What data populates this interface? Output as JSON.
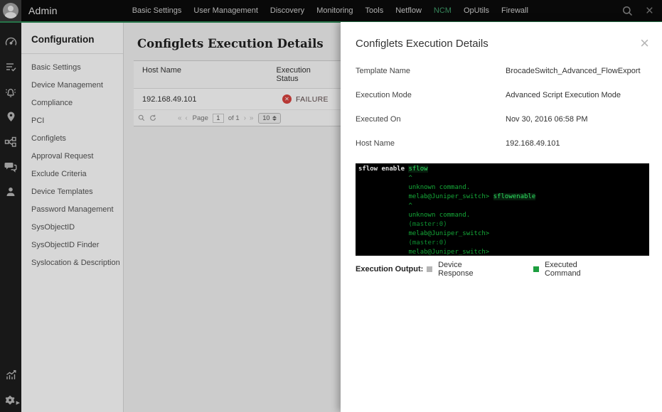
{
  "topbar": {
    "app_title": "Admin",
    "nav": [
      "Basic Settings",
      "User Management",
      "Discovery",
      "Monitoring",
      "Tools",
      "Netflow",
      "NCM",
      "OpUtils",
      "Firewall"
    ],
    "active_nav": "NCM",
    "close_glyph": "×"
  },
  "rail": {
    "icons": [
      "dashboard-gauge-icon",
      "inventory-list-icon",
      "alarm-bell-icon",
      "location-pin-icon",
      "topology-icon",
      "chat-icon",
      "user-icon",
      "reports-graph-icon",
      "settings-gear-icon"
    ]
  },
  "sidebar": {
    "title": "Configuration",
    "items": [
      "Basic Settings",
      "Device Management",
      "Compliance",
      "PCI",
      "Configlets",
      "Approval Request",
      "Exclude Criteria",
      "Device Templates",
      "Password Management",
      "SysObjectID",
      "SysObjectID Finder",
      "Syslocation & Description"
    ]
  },
  "main": {
    "heading": "Configlets Execution Details",
    "table": {
      "columns": [
        "Host Name",
        "Execution Status"
      ],
      "rows": [
        {
          "host_name": "192.168.49.101",
          "status": "FAILURE"
        }
      ]
    },
    "pagination": {
      "first_prev": "« ‹",
      "page_label": "Page",
      "page_value": "1",
      "of_label": "of 1",
      "next_last": "› »",
      "page_size": "10"
    }
  },
  "panel": {
    "title": "Configlets Execution Details",
    "close_glyph": "×",
    "fields": [
      {
        "label": "Template Name",
        "value": "BrocadeSwitch_Advanced_FlowExport"
      },
      {
        "label": "Execution Mode",
        "value": "Advanced Script Execution Mode"
      },
      {
        "label": "Executed On",
        "value": "Nov 30, 2016 06:58 PM"
      },
      {
        "label": "Host Name",
        "value": "192.168.49.101"
      }
    ],
    "terminal": {
      "lines": [
        [
          {
            "t": "sflow enable ",
            "c": "r"
          },
          {
            "t": "sflow",
            "c": "c"
          }
        ],
        [
          {
            "t": "             ^",
            "c": "o"
          }
        ],
        [
          {
            "t": "             unknown command.",
            "c": "o"
          }
        ],
        [
          {
            "t": "             melab@Juniper_switch> ",
            "c": "o"
          },
          {
            "t": "sflowenable",
            "c": "c"
          }
        ],
        [
          {
            "t": "             ^",
            "c": "o"
          }
        ],
        [
          {
            "t": "             unknown command.",
            "c": "o"
          }
        ],
        [
          {
            "t": "             (master:0)",
            "c": "d"
          }
        ],
        [
          {
            "t": "             melab@Juniper_switch>",
            "c": "o"
          }
        ],
        [
          {
            "t": "             (master:0)",
            "c": "d"
          }
        ],
        [
          {
            "t": "             melab@Juniper_switch>",
            "c": "o"
          }
        ]
      ]
    },
    "legend": {
      "label": "Execution Output:",
      "items": [
        {
          "label": "Device Response",
          "color": "#b5b5b5"
        },
        {
          "label": "Executed Command",
          "color": "#1d9e3f"
        }
      ]
    }
  },
  "colors": {
    "accent_green": "#2e8b57",
    "active_nav_green": "#3f9e6b",
    "failure_red": "#d9433f"
  }
}
